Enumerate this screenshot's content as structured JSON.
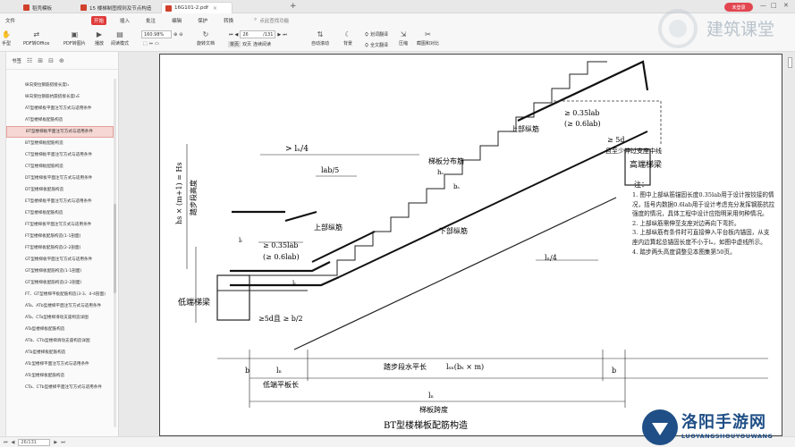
{
  "tabs": [
    {
      "label": "稻壳模板"
    },
    {
      "label": "15 楼梯制图规则及节点构造"
    },
    {
      "label": "16G101-2.pdf"
    }
  ],
  "login_label": "未登录",
  "menu": {
    "items": [
      "文件",
      "开始",
      "插入",
      "批注",
      "编辑",
      "保护",
      "转换"
    ],
    "search": "点此查找功能"
  },
  "toolbar": {
    "items": [
      "手型",
      "PDF转Office",
      "PDF转图片",
      "播放",
      "阅读模式"
    ],
    "zoom": "160.98%",
    "rotate": "旋转文档",
    "single": "单页",
    "double": "双页",
    "continuous": "连续阅读",
    "autoscroll": "自动滚动",
    "background": "背景",
    "full_translate": "全文翻译",
    "word_translate": "划词翻译",
    "compress": "压缩",
    "screenshot": "截图和对比",
    "page_input": "26",
    "page_total": "/131"
  },
  "sidebar": {
    "title": "书签",
    "items": [
      "纵向受拉钢筋搭接长度l₁",
      "纵向受拉钢筋抗震搭接长度l₁E",
      "AT型楼梯板平面注写方式与适用条件",
      "AT型楼梯板配筋构造",
      "BT型楼梯板平面注写方式与适用条件",
      "BT型楼梯板配筋构造",
      "CT型楼梯板平面注写方式与适用条件",
      "CT型楼梯板配筋构造",
      "DT型楼梯板平面注写方式与适用条件",
      "DT型楼梯板配筋构造",
      "ET型楼梯板平面注写方式与适用条件",
      "ET型楼梯板配筋构造",
      "FT型楼梯板平面注写方式与适用条件",
      "FT型楼梯板配筋构造(1-1剖面)",
      "FT型楼梯板配筋构造(2-2剖面)",
      "GT型楼梯板平面注写方式与适用条件",
      "GT型楼梯板配筋构造(1-1剖面)",
      "GT型楼梯板配筋构造(2-2剖面)",
      "FT、GT型楼梯平板配筋构造(3-3、4-4剖面)",
      "ATa、ATb型楼梯平面注写方式与适用条件",
      "ATa、CTa型楼梯滑动支座构造详图",
      "ATa型楼梯板配筋构造",
      "ATb、CTb型楼梯滑动支座构造详图",
      "ATb型楼梯板配筋构造",
      "ATc型楼梯平面注写方式与适用条件",
      "ATc型楼梯板配筋构造",
      "CTa、CTb型楼梯平面注写方式与适用条件"
    ],
    "selected_index": 4
  },
  "drawing": {
    "caption": "BT型楼梯板配筋构造",
    "labels": {
      "ln4_top": "> lₙ/4",
      "lab": "lab/5",
      "upper_bar": "上部纵筋",
      "dist_bar": "梯板分布筋",
      "lower_bar": "下部纵筋",
      "upper_bar2": "上部纵筋",
      "ratio1a": "≥ 0.35lab",
      "ratio1b": "(≥ 0.6lab)",
      "ratio2a": "≥ 0.35lab",
      "ratio2b": "(≥ 0.6lab)",
      "high_beam": "高端梯梁",
      "low_beam": "低端梯梁",
      "anchor": "且至少伸过支座中线",
      "ge5d": "≥ 5d",
      "ge5d_b": "≥5d且 ≥ b/2",
      "ln4_mid": "lₙ/4",
      "ln4_right": "lₙ/4",
      "height": "hs × (m+1) = Hs",
      "height2": "踏步段高度",
      "ln_label": "lₙ",
      "ll_label": "lₗ",
      "b_left": "b",
      "b_right": "b",
      "step_len": "踏步段水平长",
      "step_formula": "lₛₙ(bₛ × m)",
      "low_flat": "低端平板长",
      "ln_total": "lₙ",
      "span": "梯板跨度",
      "hs": "hₛ",
      "bs": "bₛ",
      "ln_left": "lₗ"
    },
    "notes_title": "注：",
    "notes": [
      "1. 图中上部纵筋锚固长度0.35lab用于设计按铰接的情况，括号内数据0.6lab用于设计考虑充分发挥钢筋抗拉强度的情况，具体工程中设计应指明采用何种情况。",
      "2. 上部纵筋需伸至支座对边再向下弯折。",
      "3. 上部纵筋有条件时可直接伸入平台板内锚固，从支座内边算起总锚固长度不小于lₐ，如图中虚线所示。",
      "4. 踏步两头高度调整见本图集第50页。"
    ]
  },
  "statusbar": {
    "page": "26",
    "total": "/131"
  },
  "watermark": {
    "top": "建筑课堂",
    "bottom_title": "洛阳手游网",
    "bottom_url": "LUOYANGSHOUYOUWANG"
  }
}
